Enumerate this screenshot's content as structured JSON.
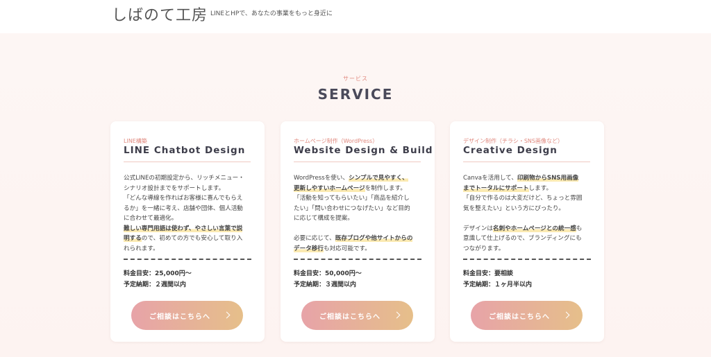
{
  "header": {
    "site_title": "しばのて工房",
    "tagline": "LINEとHPで、あなたの事業をもっと身近に"
  },
  "section": {
    "subtitle": "サービス",
    "title": "SERVICE"
  },
  "cards": [
    {
      "category": "LINE構築",
      "title": "LINE Chatbot Design",
      "desc_lines": [
        [
          {
            "t": "公式LINEの初期設定から、リッチメニュー・"
          }
        ],
        [
          {
            "t": "シナリオ設計までをサポートします。"
          }
        ],
        [
          {
            "t": "「どんな導線を作ればお客様に喜んでもらえ"
          }
        ],
        [
          {
            "t": "るか」を一緒に考え、店舗や団体、個人活動"
          }
        ],
        [
          {
            "t": "に合わせて最適化。"
          }
        ],
        [
          {
            "t": "難しい専門用語は使わず、やさしい言葉で説",
            "h": true
          }
        ],
        [
          {
            "t": "明する",
            "h": true
          },
          {
            "t": "ので、初めての方でも安心して取り入"
          }
        ],
        [
          {
            "t": "れられます。"
          }
        ]
      ],
      "price": "料金目安：25,000円〜",
      "period": "予定納期：２週間以内",
      "cta": "ご相談はこちらへ"
    },
    {
      "category": "ホームページ制作（WordPress）",
      "title": "Website Design & Build",
      "desc_lines": [
        [
          {
            "t": "WordPressを使い、"
          },
          {
            "t": "シンプルで見やすく、",
            "h": true
          }
        ],
        [
          {
            "t": "更新しやすいホームページ",
            "h": true
          },
          {
            "t": "を制作します。"
          }
        ],
        [
          {
            "t": "「活動を知ってもらいたい」「商品を紹介し"
          }
        ],
        [
          {
            "t": "たい」「問い合わせにつなげたい」など目的"
          }
        ],
        [
          {
            "t": "に応じて構成を提案。"
          }
        ],
        [
          {
            "t": ""
          }
        ],
        [
          {
            "t": "必要に応じて、"
          },
          {
            "t": "既存ブログや他サイトからの",
            "h": true
          }
        ],
        [
          {
            "t": "データ移行",
            "h": true
          },
          {
            "t": "も対応可能です。"
          }
        ]
      ],
      "price": "料金目安：50,000円〜",
      "period": "予定納期：３週間以内",
      "cta": "ご相談はこちらへ"
    },
    {
      "category": "デザイン制作（チラシ・SNS画像など）",
      "title": "Creative Design",
      "desc_lines": [
        [
          {
            "t": "Canvaを活用して、"
          },
          {
            "t": "印刷物からSNS用画像",
            "h": true
          }
        ],
        [
          {
            "t": "までトータルにサポート",
            "h": true
          },
          {
            "t": "します。"
          }
        ],
        [
          {
            "t": "「自分で作るのは大変だけど、ちょっと雰囲"
          }
        ],
        [
          {
            "t": "気を整えたい」という方にぴったり。"
          }
        ],
        [
          {
            "t": ""
          }
        ],
        [
          {
            "t": "デザインは"
          },
          {
            "t": "名刺やホームページとの統一感",
            "h": true
          },
          {
            "t": "も"
          }
        ],
        [
          {
            "t": "意識して仕上げるので、ブランディングにも"
          }
        ],
        [
          {
            "t": "つながります。"
          }
        ]
      ],
      "price": "料金目安：要相談",
      "period": "予定納期：１ヶ月半以内",
      "cta": "ご相談はこちらへ"
    }
  ]
}
